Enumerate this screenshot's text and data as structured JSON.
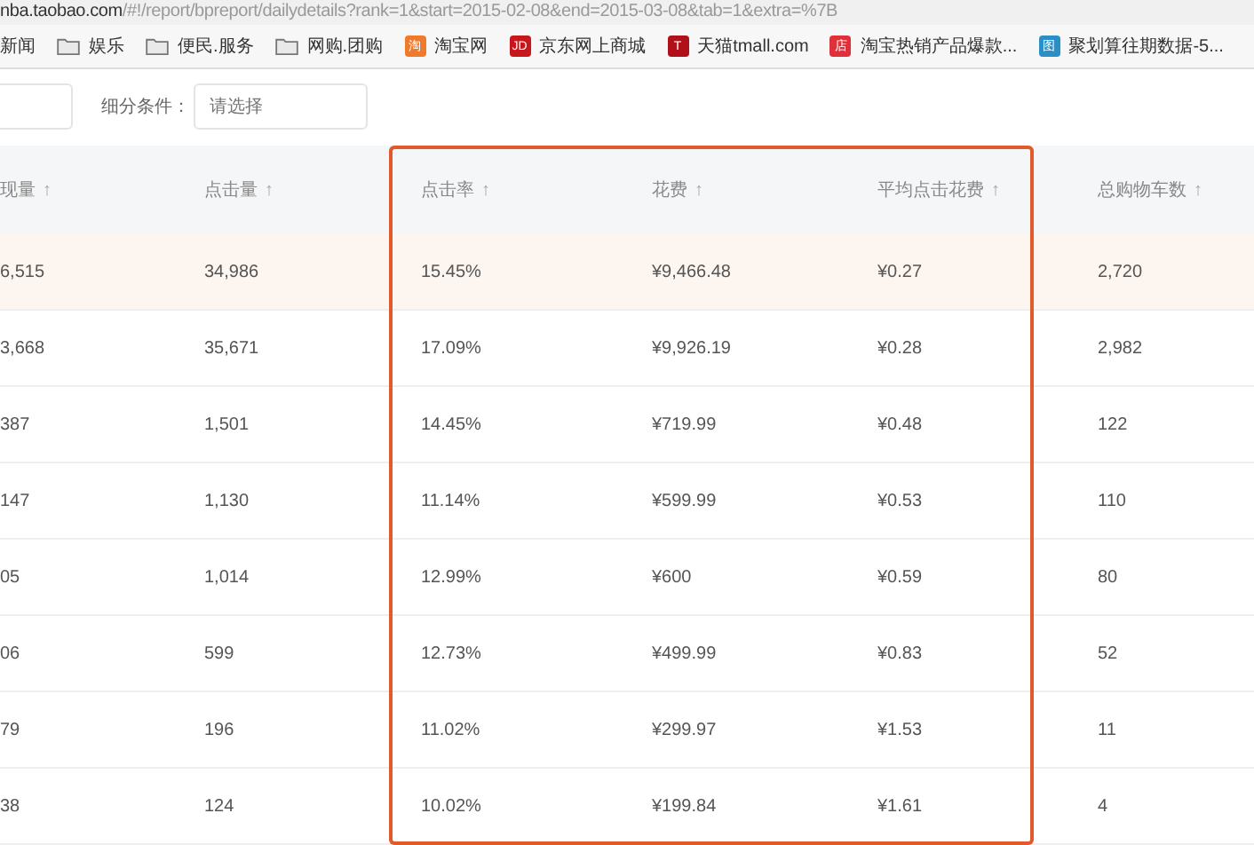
{
  "address_bar": {
    "domain": "nba.taobao.com",
    "path": "/#!/report/bpreport/dailydetails?rank=1&start=2015-02-08&end=2015-03-08&tab=1&extra=%7B"
  },
  "bookmarks": [
    {
      "kind": "text",
      "label": "新闻"
    },
    {
      "kind": "folder",
      "label": "娱乐"
    },
    {
      "kind": "folder",
      "label": "便民.服务"
    },
    {
      "kind": "folder",
      "label": "网购.团购"
    },
    {
      "kind": "site",
      "label": "淘宝网",
      "icon": "淘",
      "color": "#f07a2c"
    },
    {
      "kind": "site",
      "label": "京东网上商城",
      "icon": "JD",
      "color": "#c8161d"
    },
    {
      "kind": "site",
      "label": "天猫tmall.com",
      "icon": "T",
      "color": "#b0101a"
    },
    {
      "kind": "site",
      "label": "淘宝热销产品爆款...",
      "icon": "店",
      "color": "#e0303a"
    },
    {
      "kind": "site",
      "label": "聚划算往期数据-5...",
      "icon": "图",
      "color": "#2a8fc7"
    }
  ],
  "filter": {
    "label": "细分条件：",
    "placeholder": "请选择"
  },
  "table": {
    "columns": [
      {
        "label": "现量",
        "sort": "↑",
        "highlighted": false
      },
      {
        "label": "点击量",
        "sort": "↑",
        "highlighted": false
      },
      {
        "label": "点击率",
        "sort": "↑",
        "highlighted": true
      },
      {
        "label": "花费",
        "sort": "↑",
        "highlighted": true
      },
      {
        "label": "平均点击花费",
        "sort": "↑",
        "highlighted": true
      },
      {
        "label": "总购物车数",
        "sort": "↑",
        "highlighted": false
      }
    ],
    "rows": [
      {
        "selected": true,
        "cells": [
          "6,515",
          "34,986",
          "15.45%",
          "¥9,466.48",
          "¥0.27",
          "2,720"
        ]
      },
      {
        "selected": false,
        "cells": [
          "3,668",
          "35,671",
          "17.09%",
          "¥9,926.19",
          "¥0.28",
          "2,982"
        ]
      },
      {
        "selected": false,
        "cells": [
          "387",
          "1,501",
          "14.45%",
          "¥719.99",
          "¥0.48",
          "122"
        ]
      },
      {
        "selected": false,
        "cells": [
          "147",
          "1,130",
          "11.14%",
          "¥599.99",
          "¥0.53",
          "110"
        ]
      },
      {
        "selected": false,
        "cells": [
          "05",
          "1,014",
          "12.99%",
          "¥600",
          "¥0.59",
          "80"
        ]
      },
      {
        "selected": false,
        "cells": [
          "06",
          "599",
          "12.73%",
          "¥499.99",
          "¥0.83",
          "52"
        ]
      },
      {
        "selected": false,
        "cells": [
          "79",
          "196",
          "11.02%",
          "¥299.97",
          "¥1.53",
          "11"
        ]
      },
      {
        "selected": false,
        "cells": [
          "38",
          "124",
          "10.02%",
          "¥199.84",
          "¥1.61",
          "4"
        ]
      }
    ]
  }
}
